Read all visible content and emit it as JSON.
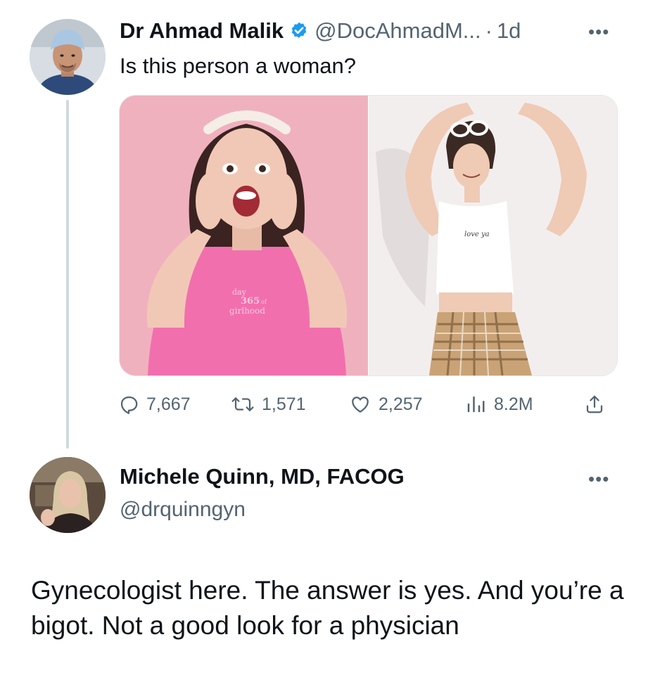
{
  "tweet": {
    "author": {
      "name": "Dr Ahmad Malik",
      "handle": "@DocAhmadM...",
      "verified": true,
      "avatar": "avatar-doctor-surgical-cap"
    },
    "separator": "·",
    "time": "1d",
    "more_icon": "more-horizontal-icon",
    "text": "Is this person a woman?",
    "media": [
      {
        "name": "photo-pink-tshirt",
        "shirt_text": {
          "line1": "day",
          "line2": "365",
          "line3": "of",
          "line4": "girlhood"
        }
      },
      {
        "name": "photo-white-croptop",
        "shirt_text": "love ya"
      }
    ],
    "actions": {
      "replies": "7,667",
      "retweets": "1,571",
      "likes": "2,257",
      "views": "8.2M"
    }
  },
  "reply": {
    "author": {
      "name": "Michele Quinn, MD, FACOG",
      "handle": "@drquinngyn",
      "avatar": "avatar-woman-blonde"
    },
    "more_icon": "more-horizontal-icon",
    "text": "Gynecologist here. The answer is yes. And you’re a bigot. Not a good look for a physician"
  },
  "colors": {
    "text_primary": "#0f1419",
    "text_secondary": "#536471",
    "verified_blue": "#1d9bf0",
    "thread_line": "#cfd9de",
    "pink_backdrop": "#f0b1bf",
    "shirt_pink": "#f26fae"
  }
}
